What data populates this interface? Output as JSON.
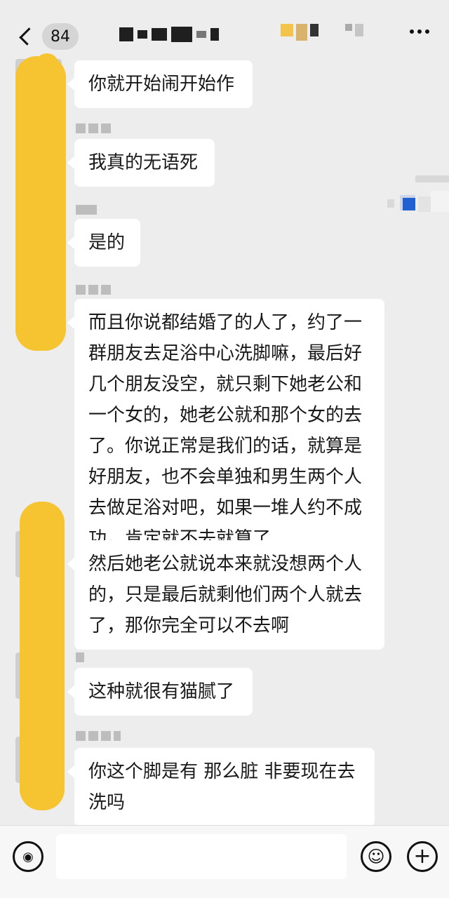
{
  "header": {
    "back_icon": "chevron-left-icon",
    "unread_count": "84",
    "more_icon": "more-dots-icon"
  },
  "messages": [
    {
      "text": "你就开始闹开始作"
    },
    {
      "text": "我真的无语死"
    },
    {
      "text": "是的"
    },
    {
      "text": "而且你说都结婚了的人了，约了一群朋友去足浴中心洗脚嘛，最后好几个朋友没空，就只剩下她老公和一个女的，她老公就和那个女的去了。你说正常是我们的话，就算是好朋友，也不会单独和男生两个人去做足浴对吧，如果一堆人约不成功，肯定就不去就算了"
    },
    {
      "text": "然后她老公就说本来就没想两个人的，只是最后就剩他们两个人就去了，那你完全可以不去啊"
    },
    {
      "text": "这种就很有猫腻了"
    },
    {
      "text": "你这个脚是有 那么脏 非要现在去洗吗"
    }
  ],
  "input_bar": {
    "voice_icon": "voice-icon",
    "emoji_icon": "emoji-icon",
    "plus_icon": "plus-icon",
    "placeholder": ""
  }
}
